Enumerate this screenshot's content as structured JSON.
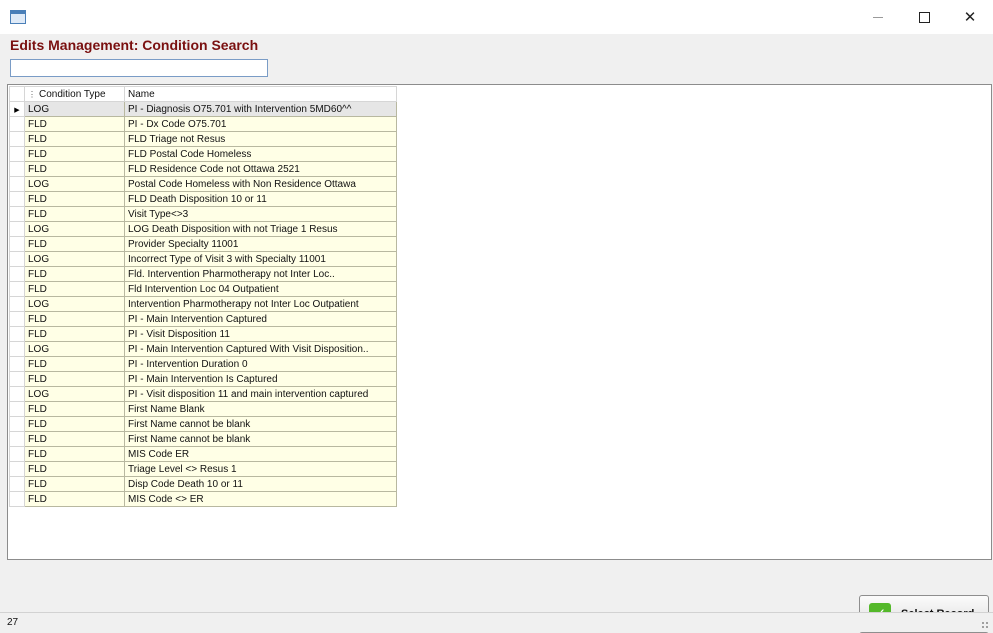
{
  "window": {
    "icon": "form-icon",
    "controls": {
      "minimize_icon": "minimize-icon",
      "maximize_icon": "maximize-icon",
      "close_icon": "close-icon",
      "close_glyph": "✕"
    }
  },
  "page": {
    "title": "Edits Management: Condition Search"
  },
  "search": {
    "value": "",
    "placeholder": ""
  },
  "grid": {
    "columns": [
      "Condition Type",
      "Name"
    ],
    "selected_row_index": 0,
    "rows": [
      {
        "type": "LOG",
        "name": "PI - Diagnosis O75.701 with Intervention 5MD60^^"
      },
      {
        "type": "FLD",
        "name": "PI - Dx Code O75.701"
      },
      {
        "type": "FLD",
        "name": "FLD Triage not Resus"
      },
      {
        "type": "FLD",
        "name": "FLD Postal Code Homeless"
      },
      {
        "type": "FLD",
        "name": "FLD Residence Code not Ottawa 2521"
      },
      {
        "type": "LOG",
        "name": "Postal Code Homeless with Non Residence Ottawa"
      },
      {
        "type": "FLD",
        "name": "FLD Death Disposition 10 or 11"
      },
      {
        "type": "FLD",
        "name": "Visit Type<>3"
      },
      {
        "type": "LOG",
        "name": "LOG Death Disposition with not Triage 1 Resus"
      },
      {
        "type": "FLD",
        "name": "Provider Specialty 11001"
      },
      {
        "type": "LOG",
        "name": "Incorrect Type of Visit 3 with Specialty 11001"
      },
      {
        "type": "FLD",
        "name": "Fld. Intervention Pharmotherapy not Inter Loc.."
      },
      {
        "type": "FLD",
        "name": "Fld Intervention Loc 04 Outpatient"
      },
      {
        "type": "LOG",
        "name": "Intervention Pharmotherapy not Inter Loc Outpatient"
      },
      {
        "type": "FLD",
        "name": "PI - Main Intervention Captured"
      },
      {
        "type": "FLD",
        "name": "PI - Visit Disposition 11"
      },
      {
        "type": "LOG",
        "name": "PI - Main Intervention Captured With Visit Disposition.."
      },
      {
        "type": "FLD",
        "name": "PI - Intervention Duration 0"
      },
      {
        "type": "FLD",
        "name": "PI - Main Intervention Is Captured"
      },
      {
        "type": "LOG",
        "name": "PI - Visit disposition 11 and main intervention captured"
      },
      {
        "type": "FLD",
        "name": "First Name Blank"
      },
      {
        "type": "FLD",
        "name": "First Name cannot be blank"
      },
      {
        "type": "FLD",
        "name": "First Name cannot be blank"
      },
      {
        "type": "FLD",
        "name": "MIS Code ER"
      },
      {
        "type": "FLD",
        "name": "Triage Level <> Resus 1"
      },
      {
        "type": "FLD",
        "name": "Disp Code Death 10 or 11"
      },
      {
        "type": "FLD",
        "name": "MIS Code <> ER"
      }
    ]
  },
  "actions": {
    "select_record_label": "Select Record",
    "select_record_icon": "checkmark-icon",
    "check_glyph": "✓"
  },
  "status": {
    "record_count": "27"
  },
  "colors": {
    "title": "#7a1010",
    "row_background": "#ffffe6",
    "check_green": "#54b82a"
  }
}
